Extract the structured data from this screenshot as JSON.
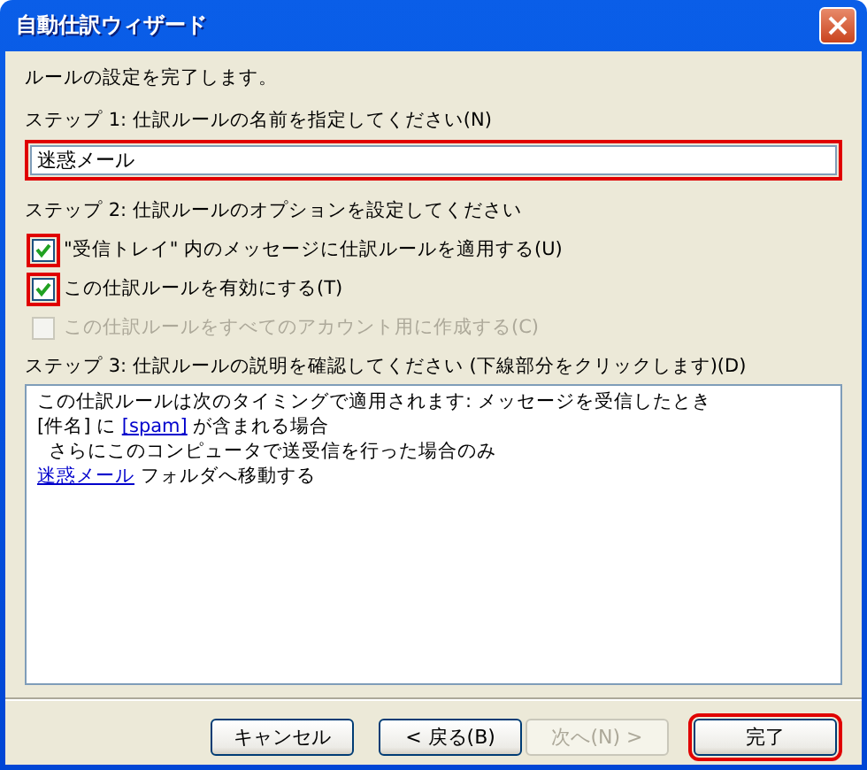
{
  "window": {
    "title": "自動仕訳ウィザード"
  },
  "intro": "ルールの設定を完了します。",
  "step1": {
    "label": "ステップ 1: 仕訳ルールの名前を指定してください(N)",
    "field": {
      "value": "迷惑メール",
      "highlighted": true
    }
  },
  "step2": {
    "label": "ステップ 2: 仕訳ルールのオプションを設定してください",
    "options": [
      {
        "label": "\"受信トレイ\" 内のメッセージに仕訳ルールを適用する(U)",
        "checked": true,
        "disabled": false,
        "highlighted": true
      },
      {
        "label": "この仕訳ルールを有効にする(T)",
        "checked": true,
        "disabled": false,
        "highlighted": true
      },
      {
        "label": "この仕訳ルールをすべてのアカウント用に作成する(C)",
        "checked": false,
        "disabled": true,
        "highlighted": false
      }
    ]
  },
  "step3": {
    "label": "ステップ 3: 仕訳ルールの説明を確認してください (下線部分をクリックします)(D)",
    "description": [
      {
        "parts": [
          {
            "text": "この仕訳ルールは次のタイミングで適用されます: メッセージを受信したとき",
            "link": false
          }
        ]
      },
      {
        "parts": [
          {
            "text": "[件名] に ",
            "link": false
          },
          {
            "text": "[spam]",
            "link": true
          },
          {
            "text": " が含まれる場合",
            "link": false
          }
        ]
      },
      {
        "parts": [
          {
            "text": "  さらにこのコンピュータで送受信を行った場合のみ",
            "link": false
          }
        ]
      },
      {
        "parts": [
          {
            "text": "迷惑メール",
            "link": true
          },
          {
            "text": " フォルダへ移動する",
            "link": false
          }
        ]
      }
    ]
  },
  "buttons": [
    {
      "label": "キャンセル",
      "disabled": false,
      "highlighted": false
    },
    {
      "label": "< 戻る(B)",
      "disabled": false,
      "highlighted": false
    },
    {
      "label": "次へ(N) >",
      "disabled": true,
      "highlighted": false
    },
    {
      "label": "完了",
      "disabled": false,
      "highlighted": true
    }
  ]
}
